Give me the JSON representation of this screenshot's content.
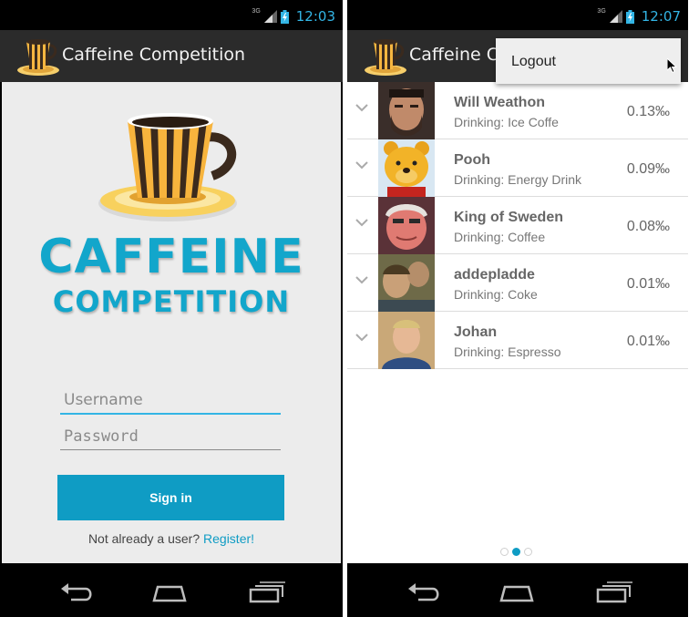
{
  "left_screen": {
    "status": {
      "network": "3G",
      "time": "12:03"
    },
    "app_title": "Caffeine Competition",
    "logo": {
      "line1": "CAFFEINE",
      "line2": "COMPETITION"
    },
    "login": {
      "username_placeholder": "Username",
      "password_placeholder": "Password",
      "signin_label": "Sign in",
      "register_prompt": "Not already a user?",
      "register_link": "Register!"
    }
  },
  "right_screen": {
    "status": {
      "network": "3G",
      "time": "12:07"
    },
    "app_title": "Caffeine C",
    "menu": {
      "logout_label": "Logout"
    },
    "leaderboard": [
      {
        "name": "Will Weathon",
        "drink": "Drinking: Ice Coffe",
        "score": "0.13‰",
        "avatar": "photo-man-beard"
      },
      {
        "name": "Pooh",
        "drink": "Drinking: Energy Drink",
        "score": "0.09‰",
        "avatar": "photo-pooh-bear"
      },
      {
        "name": "King of Sweden",
        "drink": "Drinking: Coffee",
        "score": "0.08‰",
        "avatar": "photo-old-man"
      },
      {
        "name": "addepladde",
        "drink": "Drinking: Coke",
        "score": "0.01‰",
        "avatar": "photo-kids"
      },
      {
        "name": "Johan",
        "drink": "Drinking: Espresso",
        "score": "0.01‰",
        "avatar": "photo-man-blue-shirt"
      }
    ],
    "pager": {
      "pages": 3,
      "active_index": 1
    }
  },
  "colors": {
    "accent": "#33b5e5",
    "brand_blue": "#0f9cc4",
    "action_bar": "#2b2b2b",
    "background": "#ececec"
  },
  "icons": [
    "app-cup-icon",
    "signal-icon",
    "battery-icon",
    "back-icon",
    "home-icon",
    "recents-icon",
    "chevron-down-icon",
    "mouse-cursor-icon"
  ]
}
